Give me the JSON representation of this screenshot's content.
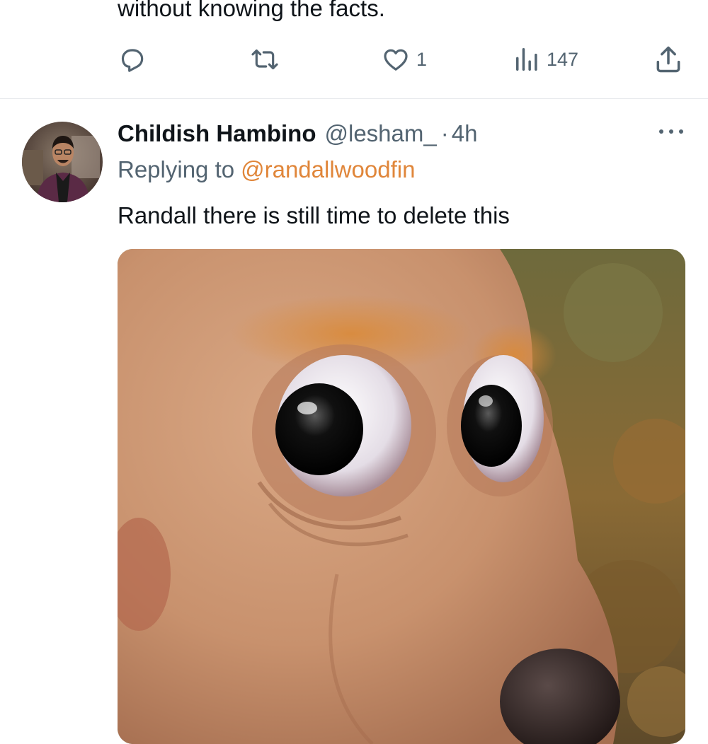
{
  "previous_tweet": {
    "text_tail": "without knowing the facts.",
    "actions": {
      "reply_count": "",
      "retweet_count": "",
      "like_count": "1",
      "view_count": "147",
      "icons": [
        "reply-icon",
        "retweet-icon",
        "like-icon",
        "views-icon",
        "share-icon"
      ]
    }
  },
  "reply_tweet": {
    "display_name": "Childish Hambino",
    "handle": "@lesham_",
    "separator": "·",
    "timestamp": "4h",
    "replying_to_label": "Replying to",
    "replying_to_handle": "@randallwoodfin",
    "text": "Randall there is still time to delete this",
    "media_description_icon": "photo-bear-puppet"
  },
  "colors": {
    "text_primary": "#0f1419",
    "text_secondary": "#536471",
    "mention": "#e0863a",
    "divider": "#e6e9ec"
  }
}
